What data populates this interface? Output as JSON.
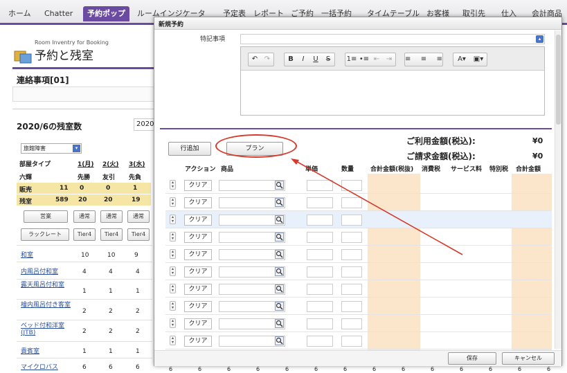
{
  "nav": {
    "tabs": [
      "ホーム",
      "Chatter",
      "予約ポップ",
      "ルームインジケータ",
      "予定表",
      "レポート",
      "ご予約",
      "一括予約",
      "タイムテーブル",
      "お客様",
      "取引先",
      "仕入",
      "会計商品"
    ],
    "active_index": 2
  },
  "app": {
    "subtitle": "Room Inventry for Booking",
    "title": "予約と残室"
  },
  "notice": {
    "heading": "連絡事項[01]"
  },
  "inventory": {
    "heading": "2020/6の残室数",
    "year_field": "2020",
    "select_value": "旅館障害",
    "col_headers": [
      "部屋タイプ",
      "1(月)",
      "2(火)",
      "3(水)"
    ],
    "rokuyo": [
      "六輝",
      "先勝",
      "友引",
      "先負"
    ],
    "sold_label": "販売",
    "sold_total": "11",
    "sold": [
      "0",
      "0",
      "1"
    ],
    "remain_label": "残室",
    "remain_total": "589",
    "remain": [
      "20",
      "20",
      "19"
    ],
    "btn_row1": [
      "営業",
      "通常",
      "通常",
      "通常"
    ],
    "btn_row2": [
      "ラックレート",
      "Tier4",
      "Tier4",
      "Tier4"
    ],
    "rooms": [
      {
        "name": "和室",
        "vals": [
          "10",
          "10",
          "9"
        ]
      },
      {
        "name": "内風呂付和室",
        "vals": [
          "4",
          "4",
          "4"
        ]
      },
      {
        "name": "露天風呂付和室",
        "vals": [
          "1",
          "1",
          "1"
        ]
      },
      {
        "name": "檜内風呂付き客室",
        "vals": [
          "2",
          "2",
          "2"
        ]
      },
      {
        "name": "ベッド付和洋室(JTB)",
        "vals": [
          "2",
          "2",
          "2"
        ]
      },
      {
        "name": "貴賓室",
        "vals": [
          "1",
          "1",
          "1"
        ]
      },
      {
        "name": "マイクロバス",
        "vals": [
          "6",
          "6",
          "6"
        ]
      }
    ]
  },
  "modal": {
    "title": "新規予約",
    "special_label": "特記事項",
    "toolbar": [
      "↶",
      "↷",
      "B",
      "I",
      "U",
      "S",
      "1≡",
      "•≡",
      "⇤",
      "⇥",
      "≡",
      "≡",
      "≡",
      "A▾",
      "▣▾"
    ],
    "add_row_label": "行追加",
    "plan_label": "プラン",
    "usage_total_label": "ご利用金額(税込):",
    "usage_total_value": "¥0",
    "billing_total_label": "ご請求金額(税込):",
    "billing_total_value": "¥0",
    "columns": [
      "アクション",
      "商品",
      "単価",
      "数量",
      "合計金額(税抜)",
      "消費税",
      "サービス料",
      "特別税",
      "合計金額"
    ],
    "row_action_label": "クリア",
    "row_count": 10,
    "highlight_row": 2,
    "save_label": "保存",
    "cancel_label": "キャンセル",
    "bottom_values": [
      "6",
      "6",
      "6",
      "6",
      "6",
      "6",
      "6",
      "6",
      "6",
      "6",
      "6",
      "6",
      "6",
      "6"
    ]
  },
  "colors": {
    "accent": "#6b4aa2",
    "annotation": "#d63a2a",
    "amount_column": "#fbe6cc",
    "highlight_row": "#e8f0fb",
    "sold_row": "#f6e6a6"
  }
}
